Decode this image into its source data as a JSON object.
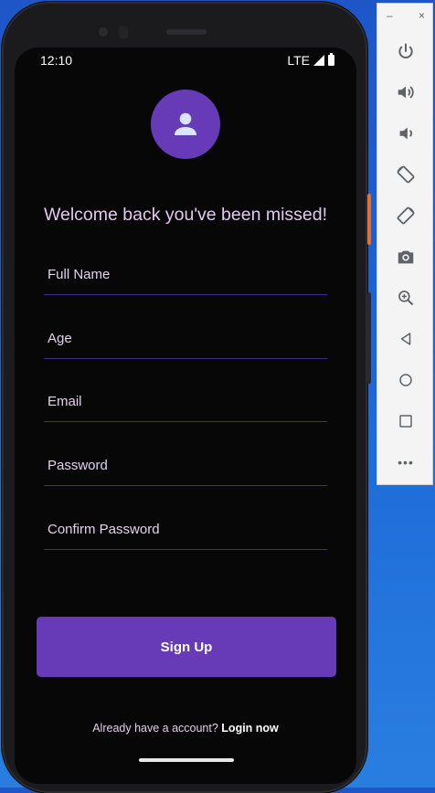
{
  "status_bar": {
    "time": "12:10",
    "network": "LTE"
  },
  "colors": {
    "accent": "#673ab7",
    "background": "#070708",
    "welcome_text": "#e3c8f0",
    "underline": "#3b2f8c",
    "icon_gray": "#5f6368"
  },
  "avatar": {
    "icon": "person-icon"
  },
  "welcome_text": "Welcome back you've been missed!",
  "form": {
    "full_name": {
      "placeholder": "Full Name",
      "value": ""
    },
    "age": {
      "placeholder": "Age",
      "value": ""
    },
    "email": {
      "placeholder": "Email",
      "value": ""
    },
    "password": {
      "placeholder": "Password",
      "value": ""
    },
    "confirm_password": {
      "placeholder": "Confirm Password",
      "value": ""
    }
  },
  "signup_button": {
    "label": "Sign Up"
  },
  "footer": {
    "prompt": "Already have a account?",
    "link": "Login now"
  },
  "emulator_toolbar": {
    "minimize_label": "–",
    "close_label": "×",
    "icons": [
      "power-icon",
      "volume-up-icon",
      "volume-down-icon",
      "rotate-left-icon",
      "rotate-right-icon",
      "camera-icon",
      "zoom-icon",
      "back-icon",
      "home-icon",
      "overview-icon",
      "more-icon"
    ],
    "more_label": "•••"
  }
}
